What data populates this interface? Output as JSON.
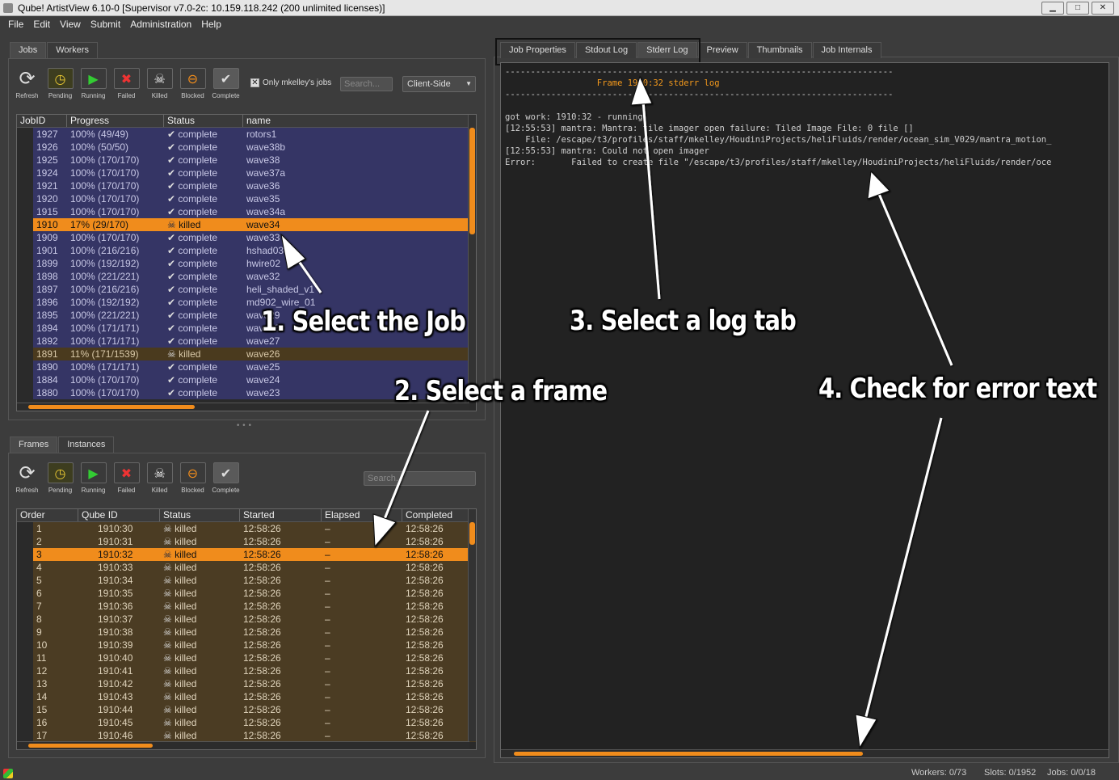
{
  "window": {
    "title": "Qube! ArtistView 6.10-0 [Supervisor v7.0-2c: 10.159.118.242 (200 unlimited licenses)]"
  },
  "menu": [
    "File",
    "Edit",
    "View",
    "Submit",
    "Administration",
    "Help"
  ],
  "jobs_panel": {
    "tabs": [
      "Jobs",
      "Workers"
    ],
    "toolbar": [
      "Refresh",
      "Pending",
      "Running",
      "Failed",
      "Killed",
      "Blocked",
      "Complete"
    ],
    "only_mine_label": "Only mkelley's jobs",
    "search_placeholder": "Search...",
    "mode_select": "Client-Side",
    "columns": [
      "JobID",
      "Progress",
      "Status",
      "name"
    ],
    "rows": [
      [
        "1927",
        "100% (49/49)",
        "complete",
        "rotors1"
      ],
      [
        "1926",
        "100% (50/50)",
        "complete",
        "wave38b"
      ],
      [
        "1925",
        "100% (170/170)",
        "complete",
        "wave38"
      ],
      [
        "1924",
        "100% (170/170)",
        "complete",
        "wave37a"
      ],
      [
        "1921",
        "100% (170/170)",
        "complete",
        "wave36"
      ],
      [
        "1920",
        "100% (170/170)",
        "complete",
        "wave35"
      ],
      [
        "1915",
        "100% (170/170)",
        "complete",
        "wave34a"
      ],
      [
        "1910",
        "17% (29/170)",
        "killed",
        "wave34"
      ],
      [
        "1909",
        "100% (170/170)",
        "complete",
        "wave33"
      ],
      [
        "1901",
        "100% (216/216)",
        "complete",
        "hshad03"
      ],
      [
        "1899",
        "100% (192/192)",
        "complete",
        "hwire02"
      ],
      [
        "1898",
        "100% (221/221)",
        "complete",
        "wave32"
      ],
      [
        "1897",
        "100% (216/216)",
        "complete",
        "heli_shaded_v1"
      ],
      [
        "1896",
        "100% (192/192)",
        "complete",
        "md902_wire_01"
      ],
      [
        "1895",
        "100% (221/221)",
        "complete",
        "wave29"
      ],
      [
        "1894",
        "100% (171/171)",
        "complete",
        "wave28"
      ],
      [
        "1892",
        "100% (171/171)",
        "complete",
        "wave27"
      ],
      [
        "1891",
        "11% (171/1539)",
        "killed",
        "wave26"
      ],
      [
        "1890",
        "100% (171/171)",
        "complete",
        "wave25"
      ],
      [
        "1884",
        "100% (170/170)",
        "complete",
        "wave24"
      ],
      [
        "1880",
        "100% (170/170)",
        "complete",
        "wave23"
      ]
    ]
  },
  "frames_panel": {
    "tabs": [
      "Frames",
      "Instances"
    ],
    "toolbar": [
      "Refresh",
      "Pending",
      "Running",
      "Failed",
      "Killed",
      "Blocked",
      "Complete"
    ],
    "search_placeholder": "Search...",
    "columns": [
      "Order",
      "Qube ID",
      "Status",
      "Started",
      "Elapsed",
      "Completed"
    ],
    "rows": [
      [
        "1",
        "1910:30",
        "killed",
        "12:58:26",
        "–",
        "12:58:26"
      ],
      [
        "2",
        "1910:31",
        "killed",
        "12:58:26",
        "–",
        "12:58:26"
      ],
      [
        "3",
        "1910:32",
        "killed",
        "12:58:26",
        "–",
        "12:58:26"
      ],
      [
        "4",
        "1910:33",
        "killed",
        "12:58:26",
        "–",
        "12:58:26"
      ],
      [
        "5",
        "1910:34",
        "killed",
        "12:58:26",
        "–",
        "12:58:26"
      ],
      [
        "6",
        "1910:35",
        "killed",
        "12:58:26",
        "–",
        "12:58:26"
      ],
      [
        "7",
        "1910:36",
        "killed",
        "12:58:26",
        "–",
        "12:58:26"
      ],
      [
        "8",
        "1910:37",
        "killed",
        "12:58:26",
        "–",
        "12:58:26"
      ],
      [
        "9",
        "1910:38",
        "killed",
        "12:58:26",
        "–",
        "12:58:26"
      ],
      [
        "10",
        "1910:39",
        "killed",
        "12:58:26",
        "–",
        "12:58:26"
      ],
      [
        "11",
        "1910:40",
        "killed",
        "12:58:26",
        "–",
        "12:58:26"
      ],
      [
        "12",
        "1910:41",
        "killed",
        "12:58:26",
        "–",
        "12:58:26"
      ],
      [
        "13",
        "1910:42",
        "killed",
        "12:58:26",
        "–",
        "12:58:26"
      ],
      [
        "14",
        "1910:43",
        "killed",
        "12:58:26",
        "–",
        "12:58:26"
      ],
      [
        "15",
        "1910:44",
        "killed",
        "12:58:26",
        "–",
        "12:58:26"
      ],
      [
        "16",
        "1910:45",
        "killed",
        "12:58:26",
        "–",
        "12:58:26"
      ],
      [
        "17",
        "1910:46",
        "killed",
        "12:58:26",
        "–",
        "12:58:26"
      ]
    ]
  },
  "right_tabs": [
    "Job Properties",
    "Stdout Log",
    "Stderr Log",
    "Preview",
    "Thumbnails",
    "Job Internals"
  ],
  "log": {
    "separator": "----------------------------------------------------------------------------",
    "header": "Frame 1910:32 stderr log",
    "lines": [
      "got work: 1910:32 - running",
      "[12:55:53] mantra: Mantra: tile imager open failure: Tiled Image File: 0 file []",
      "    File: /escape/t3/profiles/staff/mkelley/HoudiniProjects/heliFluids/render/ocean_sim_V029/mantra_motion_",
      "[12:55:53] mantra: Could not open imager",
      "Error:       Failed to create file \"/escape/t3/profiles/staff/mkelley/HoudiniProjects/heliFluids/render/oce"
    ]
  },
  "annotations": {
    "a1": "1. Select the Job",
    "a2": "2. Select a frame",
    "a3": "3. Select a log tab",
    "a4": "4. Check for error text"
  },
  "status": {
    "workers": "Workers: 0/73",
    "slots": "Slots: 0/1952",
    "jobs": "Jobs: 0/0/18"
  },
  "colors": {
    "accent": "#f08c1c",
    "job_row": "#353565",
    "killed_row": "#4a3a1e"
  }
}
